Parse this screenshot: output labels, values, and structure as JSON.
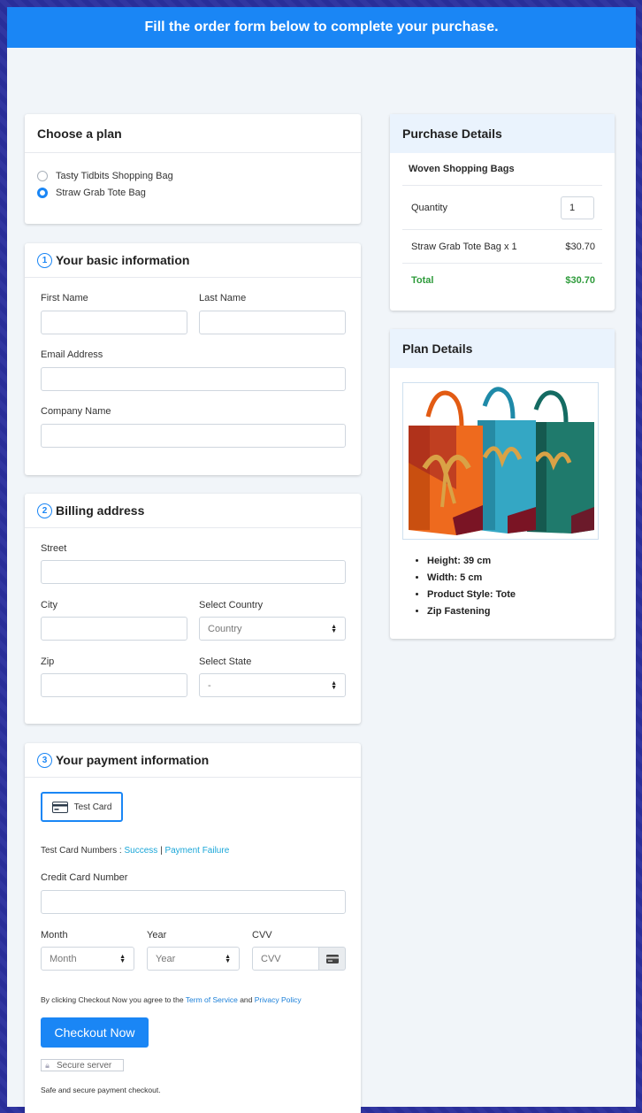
{
  "header": {
    "title": "Fill the order form below to complete your purchase."
  },
  "plan": {
    "title": "Choose a plan",
    "options": [
      "Tasty Tidbits Shopping Bag",
      "Straw Grab Tote Bag"
    ],
    "selected_index": 1
  },
  "basic": {
    "step": "1",
    "title": "Your basic information",
    "first_name_label": "First Name",
    "last_name_label": "Last Name",
    "email_label": "Email Address",
    "company_label": "Company Name"
  },
  "billing": {
    "step": "2",
    "title": "Billing address",
    "street_label": "Street",
    "city_label": "City",
    "country_label": "Select Country",
    "country_value": "Country",
    "zip_label": "Zip",
    "state_label": "Select State",
    "state_value": "-"
  },
  "payment": {
    "step": "3",
    "title": "Your payment information",
    "test_card_label": "Test Card",
    "test_numbers_prefix": "Test Card Numbers : ",
    "success_link": "Success",
    "separator": "|",
    "failure_link": "Payment Failure",
    "cc_label": "Credit Card Number",
    "month_label": "Month",
    "month_value": "Month",
    "year_label": "Year",
    "year_value": "Year",
    "cvv_label": "CVV",
    "cvv_placeholder": "CVV",
    "agree_prefix": "By clicking Checkout Now you agree to the ",
    "terms_link": "Term of Service",
    "agree_and": " and ",
    "privacy_link": "Privacy Policy",
    "checkout_label": "Checkout Now",
    "secure_label": "Secure server",
    "safe_text": "Safe and secure payment checkout."
  },
  "purchase": {
    "title": "Purchase Details",
    "product": "Woven Shopping Bags",
    "quantity_label": "Quantity",
    "quantity_value": "1",
    "line_item": "Straw Grab Tote Bag x 1",
    "line_price": "$30.70",
    "total_label": "Total",
    "total_value": "$30.70"
  },
  "plan_details": {
    "title": "Plan Details",
    "features": [
      "Height: 39 cm",
      "Width: 5 cm",
      "Product Style: Tote",
      "Zip Fastening"
    ]
  },
  "colors": {
    "accent": "#1a86f5",
    "total_green": "#2e9b3b",
    "link": "#1aa6d8"
  }
}
